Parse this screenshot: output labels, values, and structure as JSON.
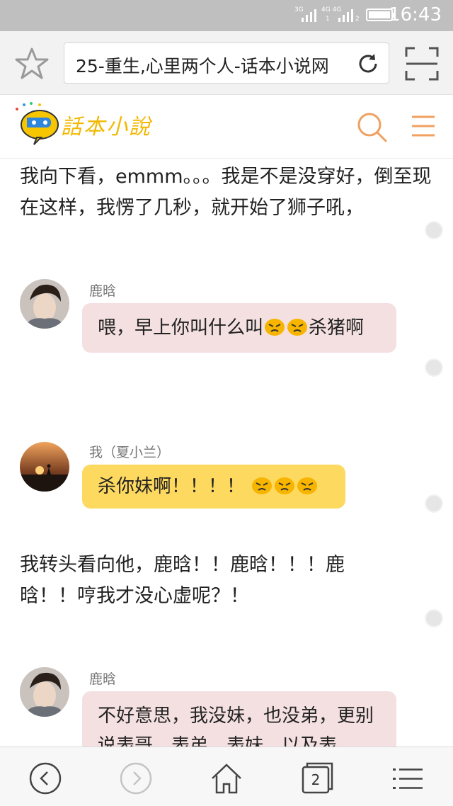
{
  "status_bar": {
    "time": "16:43",
    "network_1": "3G",
    "network_2": "4G 4G",
    "sim_badge_1": "1",
    "sim_badge_2": "2"
  },
  "browser": {
    "url_title": "25-重生,心里两个人-话本小说网",
    "tab_count": "2"
  },
  "site": {
    "logo_text": "話本小說",
    "accent_color": "#f0a060",
    "logo_color": "#f2b800"
  },
  "story": {
    "paragraph_1": "我向下看，emmm。。。我是不是没穿好，倒至现在这样，我愣了几秒，就开始了狮子吼，",
    "msg_1": {
      "speaker": "鹿晗",
      "text_before": "喂，早上你叫什么叫",
      "emoji": "angry-face",
      "text_after": "杀猪啊"
    },
    "msg_2": {
      "speaker": "我（夏小兰）",
      "text": "杀你妹啊！！！！"
    },
    "paragraph_2": "我转头看向他，鹿晗！！鹿晗！！！鹿晗！！哼我才没心虚呢？！",
    "msg_3": {
      "speaker": "鹿晗",
      "text": "不好意思，我没妹，也没弟，更别说表哥，表弟，表妹，以及表"
    }
  },
  "colors": {
    "bubble_pink": "#f4e0e1",
    "bubble_yellow": "#fed960",
    "status_bar_bg": "#bfbfbf"
  }
}
